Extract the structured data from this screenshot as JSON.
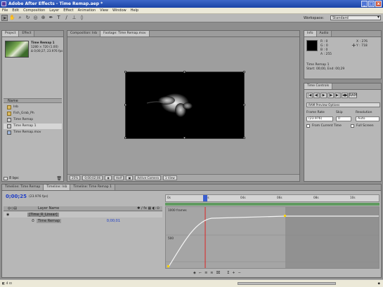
{
  "window": {
    "title": "Adobe After Effects - Time Remap.aep *",
    "min": "_",
    "max": "□",
    "close": "x"
  },
  "menu": [
    "File",
    "Edit",
    "Composition",
    "Layer",
    "Effect",
    "Animation",
    "View",
    "Window",
    "Help"
  ],
  "toolbar": {
    "tools": [
      "selection-icon",
      "hand-icon",
      "zoom-icon",
      "rotate-icon",
      "camera-icon",
      "pan-behind-icon",
      "pen-icon",
      "text-icon",
      "brush-icon",
      "clone-stamp-icon",
      "eraser-icon"
    ],
    "tool_glyphs": [
      "➤",
      "✋",
      "🔍",
      "↻",
      "◎",
      "⊕",
      "✒",
      "T",
      "/",
      "⊥",
      "◊"
    ],
    "workspace_label": "Workspace:",
    "workspace_value": "Standard"
  },
  "project": {
    "tabs": [
      "Project",
      "Effect"
    ],
    "thumb_name": "Time Remap 1",
    "info": [
      "1280 × 720 (1.00)",
      "Δ 0;00;27, 23.976 fps"
    ],
    "column_name": "Name",
    "items": [
      {
        "label": "Inb",
        "icon": "folder"
      },
      {
        "label": "Fish_Grab_Ph",
        "icon": "folder"
      },
      {
        "label": "Time Remap",
        "icon": "comp"
      },
      {
        "label": "Time Remap 1",
        "icon": "comp",
        "selected": true
      },
      {
        "label": "Time Remap.mov",
        "icon": "footage"
      }
    ],
    "footer": "8 bpc"
  },
  "viewer": {
    "tabs": [
      "Composition: Inb",
      "Footage: Time Remap.mov"
    ],
    "footer": [
      "25%",
      "0;00;02;06",
      "Half",
      "Active Camera",
      "1 View"
    ]
  },
  "info": {
    "tabs": [
      "Info",
      "Audio"
    ],
    "rgba": [
      "R : 0",
      "G : 0",
      "B : 0",
      "A : 255"
    ],
    "xy": [
      "X : 276",
      "Y : 718"
    ],
    "notes": [
      "Time Remap 1",
      "Start: 00;00, End: 00;29"
    ]
  },
  "time_controls": {
    "tabs": [
      "Time Controls"
    ],
    "buttons": [
      "|◀",
      "◀|",
      "▶",
      "|▶",
      "▶|",
      "◀▶",
      "RAM"
    ],
    "ram_options": "RAM Preview Options",
    "frame_rate_label": "Frame Rate",
    "skip_label": "Skip",
    "resolution_label": "Resolution",
    "frame_rate_value": "(23.976)",
    "skip_value": "0",
    "resolution_value": "Auto",
    "from_current": "From Current Time",
    "full_screen": "Full Screen"
  },
  "timeline": {
    "tabs": [
      "Timeline: Time Remap",
      "Timeline: Inb",
      "Timeline: Time Remap 1"
    ],
    "current_time": "0;00;25",
    "fps": "(23.976 fps)",
    "header_source": "Layer Name",
    "layer_name": "[Time_R_Linear]",
    "prop_name": "Time Remap",
    "prop_value": "0;00;01",
    "ruler_ticks": [
      "0s",
      "02s",
      "04s",
      "06s",
      "08s",
      "10s"
    ],
    "graph_labels": [
      "1000 frames",
      "500"
    ],
    "bottom_bar": [
      "◈",
      "⌐",
      "≡",
      "≋",
      "⌧",
      "Σ",
      "+",
      "−"
    ]
  },
  "status": {
    "left": "◧ 4 ⊡",
    "right": "◆"
  }
}
